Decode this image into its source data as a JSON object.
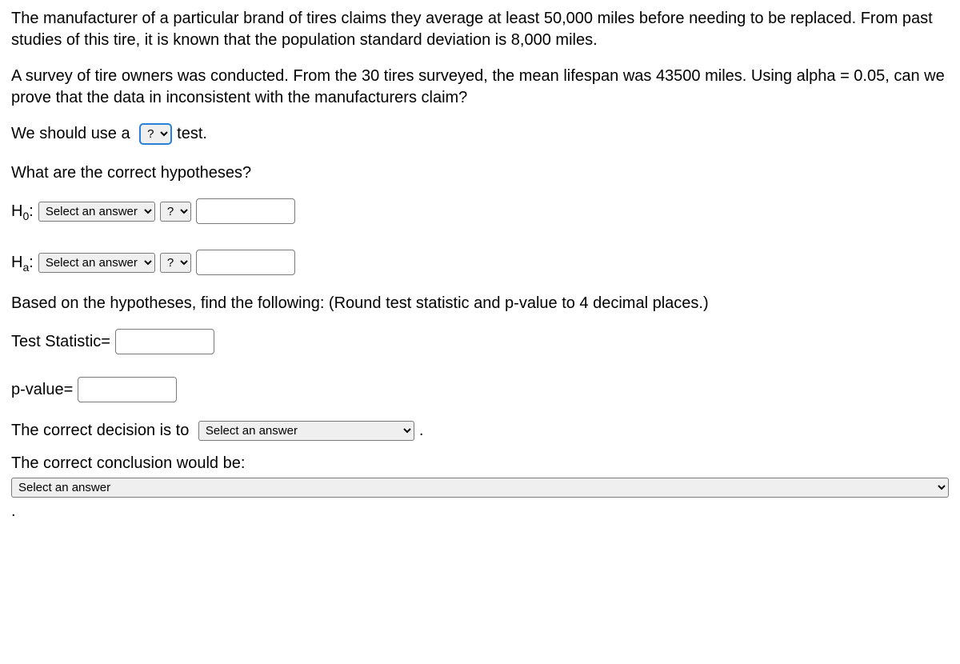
{
  "paragraphs": {
    "p1": "The manufacturer of a particular brand of tires claims they average at least 50,000 miles before needing to be replaced. From past studies of this tire, it is known that the population standard deviation is 8,000 miles.",
    "p2": "A survey of tire owners was conducted. From the 30 tires surveyed, the mean lifespan was 43500 miles. Using alpha = 0.05, can we prove that the data in inconsistent with the manufacturers claim?"
  },
  "test_type": {
    "prefix": "We should use a ",
    "select_placeholder": "?",
    "suffix": " test."
  },
  "hypotheses_question": "What are the correct hypotheses?",
  "h0": {
    "label_main": "H",
    "label_sub": "0",
    "label_colon": ": ",
    "select1_placeholder": "Select an answer",
    "select2_placeholder": "?"
  },
  "ha": {
    "label_main": "H",
    "label_sub": "a",
    "label_colon": ": ",
    "select1_placeholder": "Select an answer",
    "select2_placeholder": "?"
  },
  "instruction": "Based on the hypotheses, find the following: (Round test statistic and p-value to 4 decimal places.)",
  "test_statistic_label": "Test Statistic=",
  "pvalue_label": "p-value=",
  "decision": {
    "prefix": "The correct decision is to ",
    "select_placeholder": "Select an answer",
    "suffix": " ."
  },
  "conclusion": {
    "label": "The correct conclusion would be:",
    "select_placeholder": "Select an answer"
  }
}
